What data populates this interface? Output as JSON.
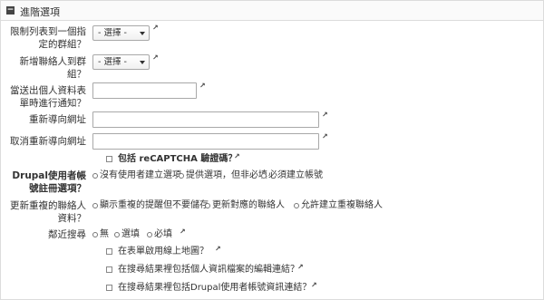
{
  "panel": {
    "title": "進階選項"
  },
  "fields": {
    "restrict_group_label": "限制列表到一個指定的群組？",
    "restrict_group_value": "- 選擇 -",
    "add_to_group_label": "新增聯絡人到群組？",
    "add_to_group_value": "- 選擇 -",
    "notify_label": "當送出個人資料表單時進行通知？",
    "notify_value": "",
    "redirect_label": "重新導向網址",
    "redirect_value": "",
    "cancel_redirect_label": "取消重新導向網址",
    "cancel_redirect_value": ""
  },
  "recaptcha": {
    "label": "包括 reCAPTCHA 驗證碼？"
  },
  "drupal_account": {
    "label": "Drupal使用者帳號註冊選項？",
    "options": [
      "沒有使用者建立選項",
      "提供選項，但非必填",
      "必須建立帳號"
    ]
  },
  "duplicate": {
    "label": "更新重複的聯絡人資料？",
    "options": [
      "顯示重複的提醒但不要儲存",
      "更新對應的聯絡人",
      "允許建立重複聯絡人"
    ]
  },
  "proximity": {
    "label": "鄰近搜尋",
    "options": [
      "無",
      "選填",
      "必填"
    ]
  },
  "checkboxes": {
    "map_link": "在表單啟用線上地圖？",
    "edit_link": "在搜尋結果裡包括個人資訊檔案的編輯連結？",
    "drupal_link": "在搜尋結果裡包括Drupal使用者帳號資訊連結？"
  },
  "icons": {
    "help": "help-icon",
    "collapse": "collapse-icon"
  }
}
